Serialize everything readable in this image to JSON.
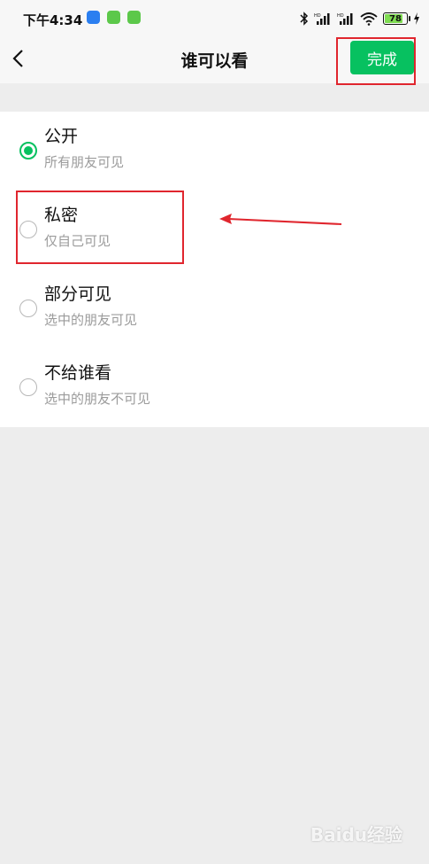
{
  "status_bar": {
    "time": "下午4:34",
    "battery": "78",
    "icons": [
      "bluetooth-icon",
      "signal-hd-icon",
      "signal-hd-icon",
      "wifi-icon",
      "battery-icon",
      "charging-icon"
    ]
  },
  "header": {
    "title": "谁可以看",
    "done_label": "完成"
  },
  "options": [
    {
      "title": "公开",
      "subtitle": "所有朋友可见",
      "selected": true
    },
    {
      "title": "私密",
      "subtitle": "仅自己可见",
      "selected": false
    },
    {
      "title": "部分可见",
      "subtitle": "选中的朋友可见",
      "selected": false
    },
    {
      "title": "不给谁看",
      "subtitle": "选中的朋友不可见",
      "selected": false
    }
  ],
  "colors": {
    "accent": "#07c160",
    "annotation": "#e0262e",
    "background": "#ededed"
  },
  "watermark": "Baidu经验"
}
